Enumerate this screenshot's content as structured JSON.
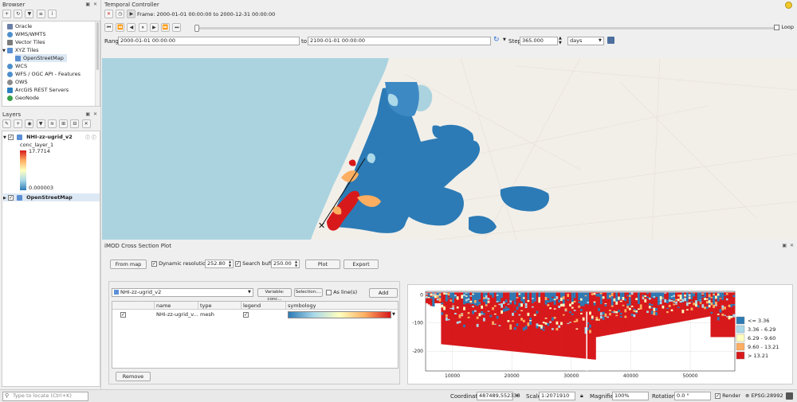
{
  "browser": {
    "title": "Browser",
    "items": [
      {
        "label": "Oracle",
        "color": "#6b7fa8"
      },
      {
        "label": "WMS/WMTS",
        "color": "#4d8fcc"
      },
      {
        "label": "Vector Tiles",
        "color": "#7b7b7b"
      },
      {
        "label": "XYZ Tiles",
        "color": "#5a8fd1"
      },
      {
        "label": "OpenStreetMap",
        "color": "#5a8fd1"
      },
      {
        "label": "WCS",
        "color": "#4d8fcc"
      },
      {
        "label": "WFS / OGC API - Features",
        "color": "#4d8fcc"
      },
      {
        "label": "OWS",
        "color": "#8b8b8b"
      },
      {
        "label": "ArcGIS REST Servers",
        "color": "#2d7fc0"
      },
      {
        "label": "GeoNode",
        "color": "#3aa04a"
      }
    ]
  },
  "layers": {
    "title": "Layers",
    "layer1": "NHI-zz-ugrid_v2",
    "variable": "conc_layer_1",
    "max": "17.7714",
    "min": "0.000003",
    "layer2": "OpenStreetMap"
  },
  "temporal": {
    "title": "Temporal Controller",
    "frame": "Frame: 2000-01-01 00:00:00 to 2000-12-31 00:00:00",
    "range_label": "Range",
    "range_start": "2000-01-01 00:00:00",
    "to_label": "to",
    "range_end": "2100-01-01 00:00:00",
    "step_label": "Step",
    "step": "365.000",
    "unit": "days",
    "loop": "Loop"
  },
  "cross_section": {
    "title": "iMOD Cross Section Plot",
    "from_map": "From map",
    "dynamic_resolution": "Dynamic resolution",
    "resolution": "252.80",
    "search_buffer_label": "Search buffer",
    "search_buffer": "250.00",
    "plot": "Plot",
    "export": "Export",
    "layer_select": "NHI-zz-ugrid_v2",
    "variable": "Variable: conc...",
    "selection": "Selection:...",
    "as_lines": "As line(s)",
    "add": "Add",
    "columns": [
      "name",
      "type",
      "legend",
      "symbology"
    ],
    "row": {
      "name": "NHI-zz-ugrid_v...",
      "type": "mesh"
    },
    "remove": "Remove"
  },
  "chart_data": {
    "type": "heatmap",
    "xlabel": "",
    "ylabel": "",
    "x_ticks": [
      "10000",
      "20000",
      "30000",
      "40000",
      "50000"
    ],
    "y_ticks": [
      "0",
      "-100",
      "-200"
    ],
    "xlim": [
      5500,
      57500
    ],
    "ylim": [
      -270,
      12
    ],
    "legend": [
      {
        "label": "<= 3.36",
        "color": "#2c7bb6"
      },
      {
        "label": "3.36 - 6.29",
        "color": "#abd9e9"
      },
      {
        "label": "6.29 - 9.60",
        "color": "#ffffbf"
      },
      {
        "label": "9.60 - 13.21",
        "color": "#fdae61"
      },
      {
        "label": "> 13.21",
        "color": "#d7191c"
      }
    ]
  },
  "statusbar": {
    "locate_placeholder": "Type to locate (Ctrl+K)",
    "coordinate_label": "Coordinate",
    "coordinate": "487489,552338",
    "scale_label": "Scale",
    "scale": "1:2071910",
    "magnifier_label": "Magnifier",
    "magnifier": "100%",
    "rotation_label": "Rotation",
    "rotation": "0.0 °",
    "render": "Render",
    "crs": "EPSG:28992"
  }
}
